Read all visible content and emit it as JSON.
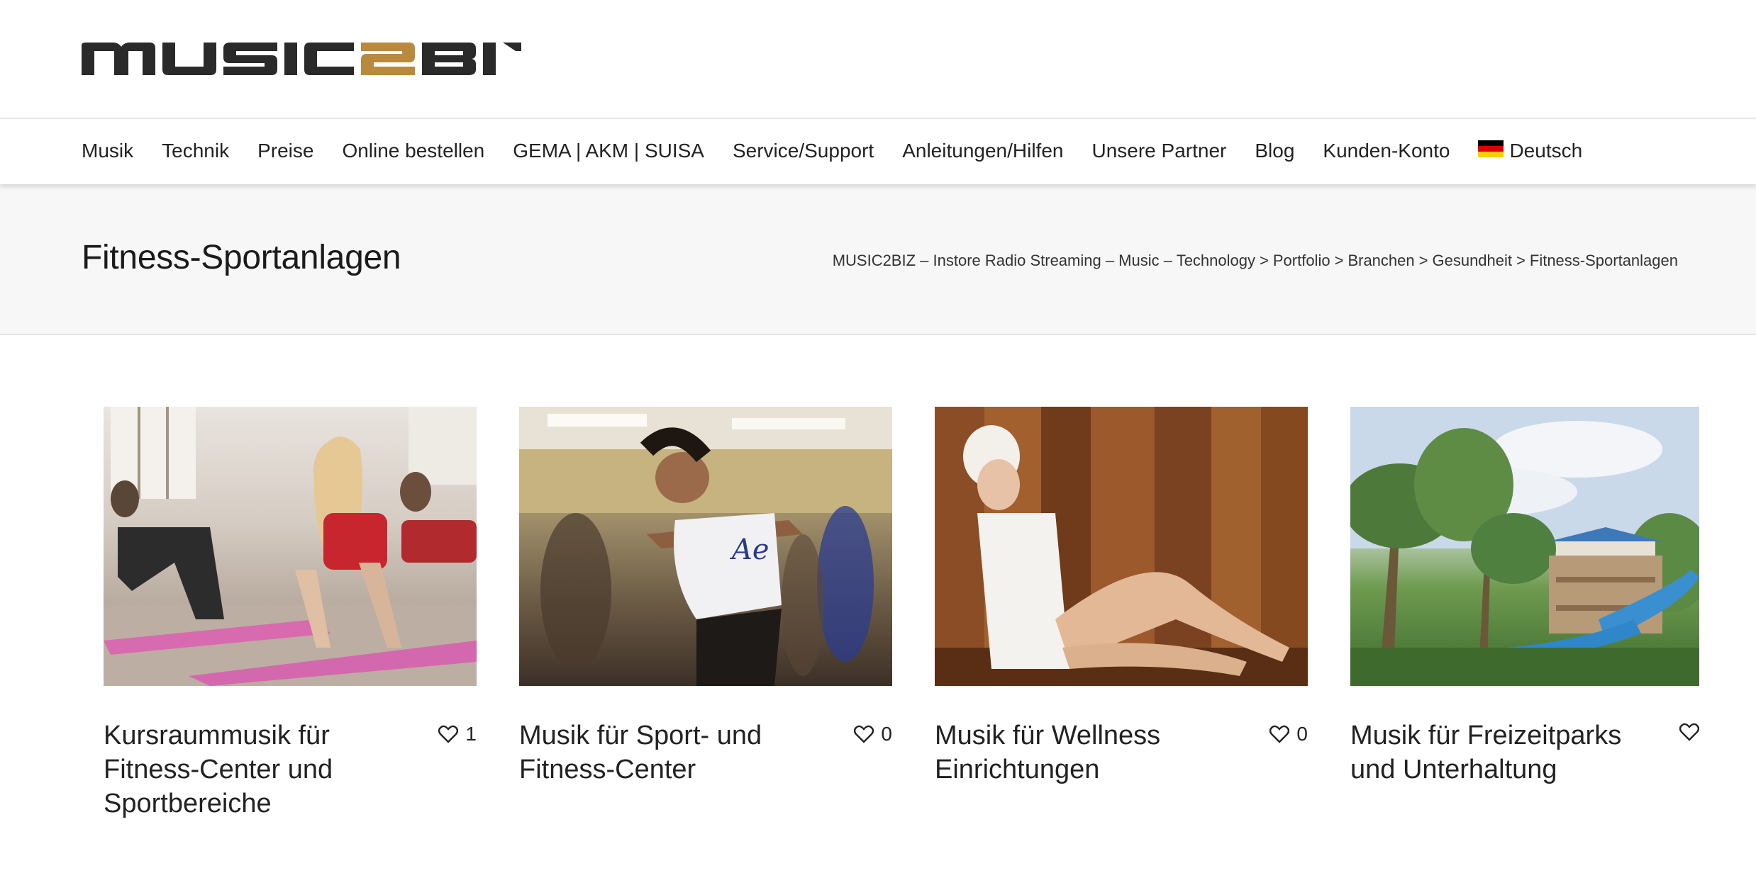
{
  "logo": {
    "alt": "MUSIC2BIZ",
    "part1": "MUSIC",
    "part2": "2",
    "part3": "BIZ"
  },
  "nav": {
    "items": [
      "Musik",
      "Technik",
      "Preise",
      "Online bestellen",
      "GEMA | AKM | SUISA",
      "Service/Support",
      "Anleitungen/Hilfen",
      "Unsere Partner",
      "Blog",
      "Kunden-Konto"
    ],
    "language": {
      "label": "Deutsch",
      "icon": "flag-de-icon"
    }
  },
  "page": {
    "title": "Fitness-Sportanlagen",
    "breadcrumb": [
      "MUSIC2BIZ – Instore Radio Streaming – Music – Technology",
      "Portfolio",
      "Branchen",
      "Gesundheit",
      "Fitness-Sportanlagen"
    ],
    "breadcrumb_separator": ">"
  },
  "portfolio": [
    {
      "title": "Kursraummusik für Fitness-Center und Sportbereiche",
      "likes": "1",
      "image": "women doing yoga on pink mats"
    },
    {
      "title": "Musik für Sport- und Fitness-Center",
      "likes": "0",
      "image": "dancer jumping in fitness studio"
    },
    {
      "title": "Musik für Wellness Einrichtungen",
      "likes": "0",
      "image": "woman relaxing in sauna"
    },
    {
      "title": "Musik für Freizeitparks und Unterhaltung",
      "likes": "",
      "image": "water park with palm trees and slides"
    }
  ],
  "colors": {
    "text": "#222222",
    "logo_dark": "#2a2a2a",
    "logo_accent": "#b98a3e",
    "titlebar_bg": "#f7f7f7"
  }
}
